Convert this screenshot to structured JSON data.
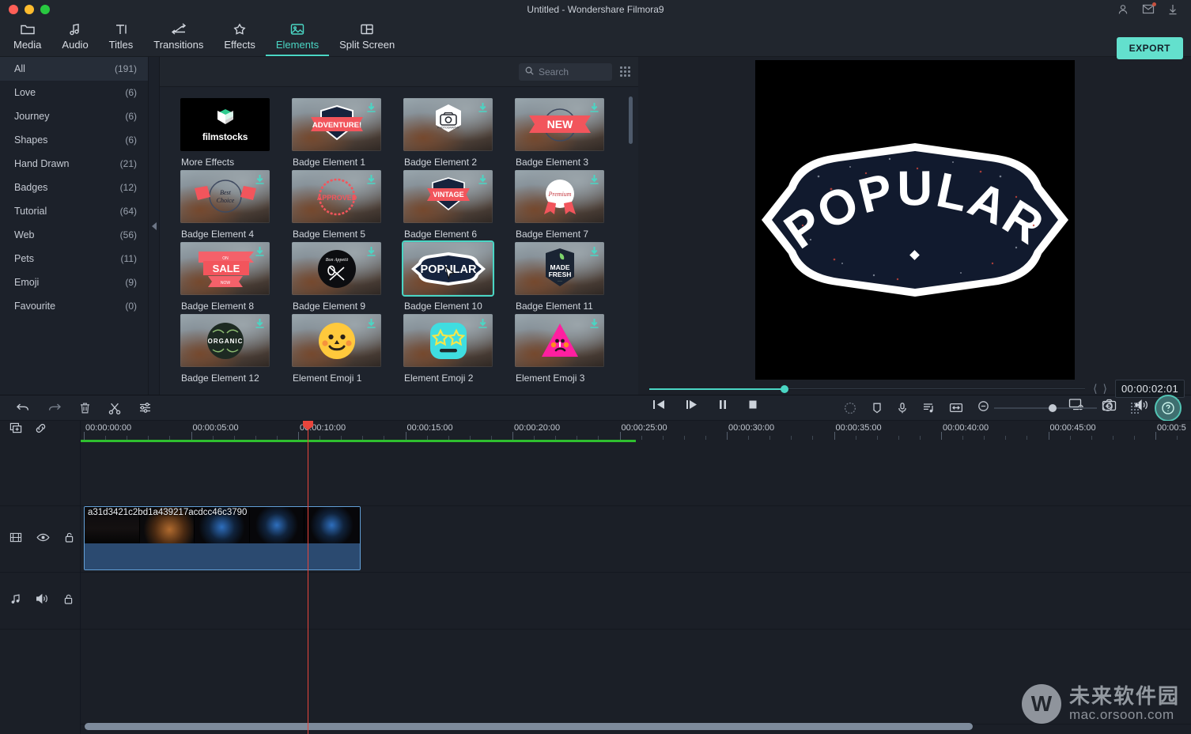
{
  "window": {
    "title": "Untitled - Wondershare Filmora9",
    "traffic_lights": [
      "close",
      "minimize",
      "maximize"
    ],
    "right_icons": [
      "account-icon",
      "mail-icon",
      "download-icon"
    ]
  },
  "topnav": {
    "items": [
      {
        "label": "Media",
        "icon": "folder-icon",
        "active": false
      },
      {
        "label": "Audio",
        "icon": "music-note-icon",
        "active": false
      },
      {
        "label": "Titles",
        "icon": "text-icon",
        "active": false
      },
      {
        "label": "Transitions",
        "icon": "transitions-icon",
        "active": false
      },
      {
        "label": "Effects",
        "icon": "sparkle-icon",
        "active": false
      },
      {
        "label": "Elements",
        "icon": "image-icon",
        "active": true
      },
      {
        "label": "Split Screen",
        "icon": "split-screen-icon",
        "active": false
      }
    ],
    "export_label": "EXPORT"
  },
  "categories": [
    {
      "label": "All",
      "count": "(191)",
      "active": true
    },
    {
      "label": "Love",
      "count": "(6)",
      "active": false
    },
    {
      "label": "Journey",
      "count": "(6)",
      "active": false
    },
    {
      "label": "Shapes",
      "count": "(6)",
      "active": false
    },
    {
      "label": "Hand Drawn",
      "count": "(21)",
      "active": false
    },
    {
      "label": "Badges",
      "count": "(12)",
      "active": false
    },
    {
      "label": "Tutorial",
      "count": "(64)",
      "active": false
    },
    {
      "label": "Web",
      "count": "(56)",
      "active": false
    },
    {
      "label": "Pets",
      "count": "(11)",
      "active": false
    },
    {
      "label": "Emoji",
      "count": "(9)",
      "active": false
    },
    {
      "label": "Favourite",
      "count": "(0)",
      "active": false
    }
  ],
  "search": {
    "placeholder": "Search",
    "value": ""
  },
  "elements": [
    {
      "name": "More Effects",
      "kind": "filmstocks",
      "badge_text": "filmstocks",
      "downloadable": false,
      "selected": false
    },
    {
      "name": "Badge Element 1",
      "kind": "badge",
      "badge_text": "ADVENTURE!",
      "downloadable": true,
      "selected": false
    },
    {
      "name": "Badge Element 2",
      "kind": "badge",
      "badge_text": "PHOTOGRAPHY",
      "downloadable": true,
      "selected": false
    },
    {
      "name": "Badge Element 3",
      "kind": "badge",
      "badge_text": "NEW",
      "downloadable": true,
      "selected": false
    },
    {
      "name": "Badge Element 4",
      "kind": "badge",
      "badge_text": "Best Choice",
      "downloadable": true,
      "selected": false
    },
    {
      "name": "Badge Element 5",
      "kind": "badge",
      "badge_text": "APPROVED",
      "downloadable": true,
      "selected": false
    },
    {
      "name": "Badge Element 6",
      "kind": "badge",
      "badge_text": "VINTAGE",
      "downloadable": true,
      "selected": false
    },
    {
      "name": "Badge Element 7",
      "kind": "badge",
      "badge_text": "Premium",
      "downloadable": true,
      "selected": false
    },
    {
      "name": "Badge Element 8",
      "kind": "badge",
      "badge_text": "SALE",
      "downloadable": true,
      "selected": false
    },
    {
      "name": "Badge Element 9",
      "kind": "badge",
      "badge_text": "Bon Appetit",
      "downloadable": true,
      "selected": false
    },
    {
      "name": "Badge Element 10",
      "kind": "badge",
      "badge_text": "POPULAR",
      "downloadable": false,
      "selected": true
    },
    {
      "name": "Badge Element 11",
      "kind": "badge",
      "badge_text": "MADE FRESH",
      "downloadable": true,
      "selected": false
    },
    {
      "name": "Badge Element 12",
      "kind": "badge",
      "badge_text": "ORGANIC",
      "downloadable": true,
      "selected": false
    },
    {
      "name": "Element Emoji 1",
      "kind": "emoji",
      "badge_text": "smile",
      "downloadable": true,
      "selected": false
    },
    {
      "name": "Element Emoji 2",
      "kind": "emoji",
      "badge_text": "star-eyes",
      "downloadable": true,
      "selected": false
    },
    {
      "name": "Element Emoji 3",
      "kind": "emoji",
      "badge_text": "sad-triangle",
      "downloadable": true,
      "selected": false
    }
  ],
  "preview": {
    "badge_text": "POPULAR",
    "timecode": "00:00:02:01",
    "seek_percent": 31,
    "transport": [
      "step-back-icon",
      "play-icon",
      "pause-icon",
      "stop-icon"
    ],
    "right_tools": [
      "render-settings-icon",
      "snapshot-icon",
      "volume-icon",
      "fullscreen-icon"
    ],
    "markers": [
      "mark-in-icon",
      "mark-out-icon"
    ]
  },
  "timeline": {
    "toolbar_left": [
      "undo-icon",
      "redo-icon",
      "delete-icon",
      "cut-icon",
      "settings-sliders-icon"
    ],
    "toolbar_right": [
      "render-preview-icon",
      "marker-icon",
      "voiceover-icon",
      "audio-mixer-icon",
      "fit-timeline-icon"
    ],
    "zoom": {
      "minus": "zoom-out-icon",
      "plus": "zoom-in-icon",
      "percent": 53
    },
    "help_label": "?",
    "track_head_icons": [
      "add-track-icon",
      "link-icon"
    ],
    "ruler_labels": [
      "00:00:00:00",
      "00:00:05:00",
      "00:00:10:00",
      "00:00:15:00",
      "00:00:20:00",
      "00:00:25:00",
      "00:00:30:00",
      "00:00:35:00",
      "00:00:40:00",
      "00:00:45:00",
      "00:00:5"
    ],
    "playhead_time": "00:00:10:00",
    "render_bar_end_percent": 50,
    "video_track": {
      "icons": [
        "film-icon",
        "eye-icon",
        "lock-icon"
      ],
      "clip_label": "a31d3421c2bd1a439217acdcc46c3790"
    },
    "audio_track": {
      "icons": [
        "music-icon",
        "speaker-icon",
        "lock-icon"
      ]
    }
  },
  "watermark": {
    "logo": "W",
    "chinese": "未来软件园",
    "url": "mac.orsoon.com"
  },
  "colors": {
    "accent": "#4ad6c4",
    "export": "#63e0cd",
    "playhead": "#e8453c",
    "render_bar": "#2fbf2f",
    "clip_body": "#2b4a70",
    "panel_bg": "#1e232c"
  }
}
